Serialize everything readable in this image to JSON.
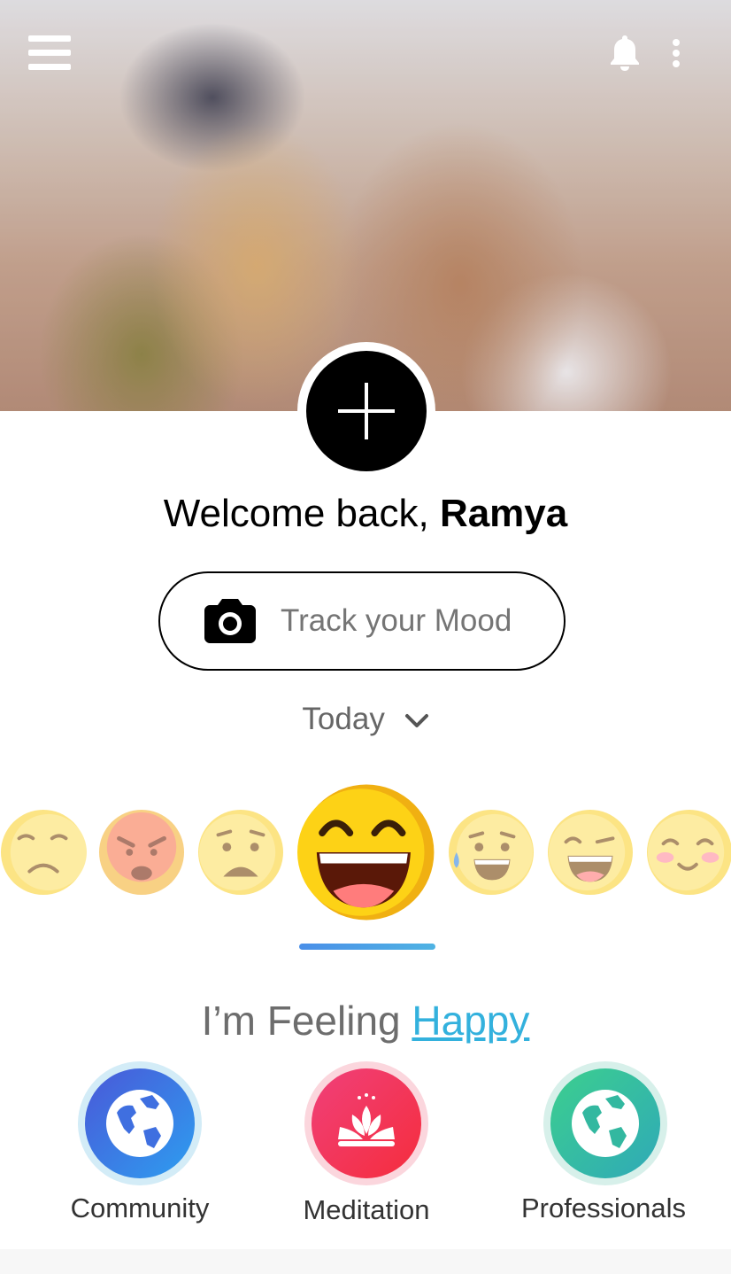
{
  "header": {
    "menu_icon": "hamburger-menu-icon",
    "notification_icon": "bell-icon",
    "more_icon": "vertical-dots-icon"
  },
  "add_button": {
    "icon": "plus-icon"
  },
  "welcome": {
    "prefix": "Welcome back, ",
    "name": "Ramya"
  },
  "track_mood": {
    "label": "Track your Mood",
    "icon": "camera-icon"
  },
  "period": {
    "label": "Today",
    "icon": "chevron-down-icon"
  },
  "moods": {
    "items": [
      "sad",
      "angry",
      "worried",
      "happy",
      "relieved",
      "grinning",
      "blushing"
    ],
    "selected": "happy"
  },
  "feeling": {
    "prefix": "I’m Feeling ",
    "mood": "Happy"
  },
  "features": [
    {
      "label": "Community",
      "icon": "globe-icon"
    },
    {
      "label": "Meditation",
      "icon": "lotus-icon"
    },
    {
      "label": "Professionals",
      "icon": "globe-icon"
    }
  ],
  "colors": {
    "accent_blue": "#33b1dd",
    "community": "#3b6ee0",
    "meditation": "#f0325a",
    "professionals": "#2fb9a2"
  }
}
